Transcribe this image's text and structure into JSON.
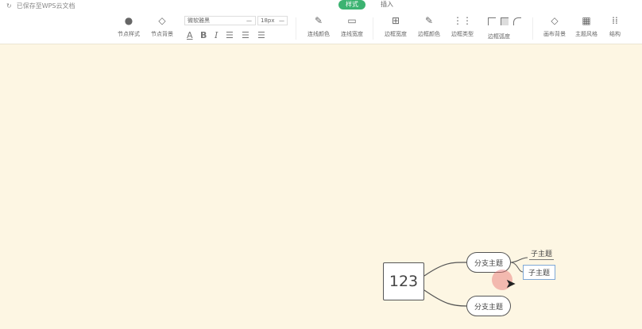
{
  "topbar": {
    "saved_status": "已保存至WPS云文档",
    "tabs": [
      {
        "label": "样式",
        "active": true
      },
      {
        "label": "插入",
        "active": false
      }
    ]
  },
  "toolbar": {
    "node_style": "节点样式",
    "node_bg": "节点背景",
    "font_family": "微软雅黑",
    "font_size": "18px",
    "bold": "B",
    "italic": "I",
    "font_color": "A",
    "line_color": "连线颜色",
    "line_width": "连线宽度",
    "border_width": "边框宽度",
    "border_color": "边框颜色",
    "border_type": "边框类型",
    "border_radius": "边框弧度",
    "canvas_bg": "画布背景",
    "theme_style": "主题风格",
    "structure": "结构"
  },
  "mindmap": {
    "root": "123",
    "branches": [
      "分支主题",
      "分支主题"
    ],
    "subtopics": [
      "子主题",
      "子主题"
    ]
  },
  "colors": {
    "canvas": "#fdf6e3",
    "accent": "#3cb371",
    "selected_border": "#7fa8d6"
  }
}
